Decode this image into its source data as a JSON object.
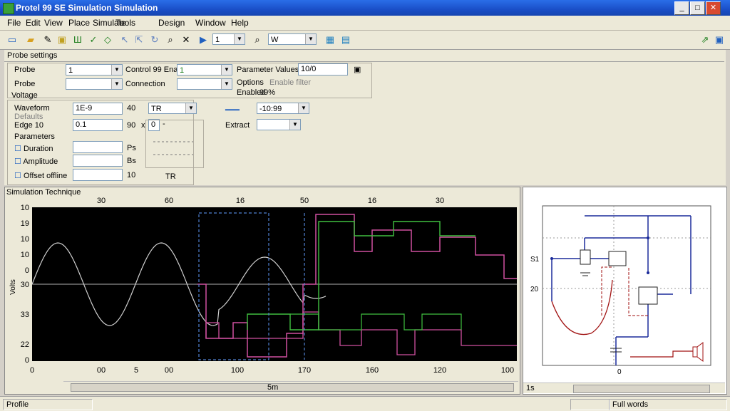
{
  "window": {
    "title": "Protel 99 SE Simulation Simulation"
  },
  "menu": [
    "File",
    "Edit",
    "View",
    "Place",
    "Simulate",
    "Tools",
    "Design",
    "Window",
    "Help"
  ],
  "toolbar": {
    "zoom_value": "1",
    "find_value": "W"
  },
  "settings": {
    "header": "Probe settings",
    "profile_label": "Probe",
    "profile_value": "1",
    "probe_label": "Probe",
    "control_label": "Control 99 Ena",
    "control_value": "1",
    "connection_label": "Connection",
    "connection_value": "",
    "parameter_label": "Parameter Values",
    "parameter_value": "10/0",
    "options_label": "Options",
    "options_grey": "Enable filter",
    "enabled_label": "Enabled",
    "enabled_value": "99%",
    "voltage_header": "Voltage",
    "wave_label": "Waveform",
    "wave_value": "1E-9",
    "wave_unit": "40",
    "wave_combo": "TR",
    "grey_label": "Defaults",
    "edge_label": "Edge 10",
    "edge_value": "0.1",
    "edge_unit": "90",
    "edge_x": "x",
    "edge_box": "0",
    "param_header": "Parameters",
    "p1_label": "Duration",
    "p1_unit": "Ps",
    "p2_label": "Amplitude",
    "p2_unit": "Bs",
    "p3_label": "Offset offline",
    "p3_value": "10",
    "p3_unit": "TR",
    "right_combo": "-10:99",
    "extract_label": "Extract",
    "extract_value": ""
  },
  "waveform": {
    "title": "Simulation Technique",
    "top_ticks": [
      "30",
      "60",
      "16",
      "50",
      "16",
      "30"
    ],
    "bottom_ticks": [
      "00",
      "5",
      "00",
      "100",
      "170",
      "160",
      "120",
      "100"
    ],
    "left_ticks": [
      "10",
      "19",
      "10",
      "10",
      "0",
      "30",
      "33",
      "22",
      "0"
    ],
    "ylabel": "Volts",
    "xlabel": "5m",
    "colors": {
      "bg": "#000000",
      "sine": "#d0d0d0",
      "pink": "#d050a0",
      "green": "#40c040",
      "dash": "#5080d0"
    }
  },
  "schematic": {
    "label_left_top": "S1",
    "label_left_mid": "20",
    "label_bottom": "0",
    "colors": {
      "wire": "#1a2a9a",
      "red": "#a01010"
    }
  },
  "statusbar": {
    "left": "Profile",
    "mid": "Full words"
  },
  "scroll_label": "1s"
}
